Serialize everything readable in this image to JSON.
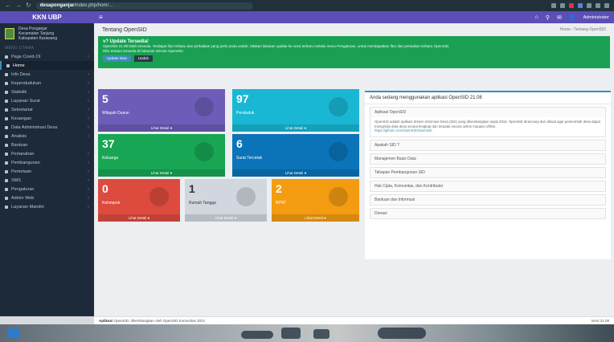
{
  "browser": {
    "url_host": "desaponganjar",
    "url_path": "/index.php/hom/...",
    "nav_back": "←",
    "nav_forward": "→",
    "nav_reload": "↻"
  },
  "sidebar": {
    "brand": "KKN UBP",
    "village_lines": [
      "Desa Ponganjar",
      "Kecamatan Tanjung",
      "Kabupaten Karawang"
    ],
    "menu_header": "MENU UTAMA",
    "items": [
      {
        "label": "Page Covid-19",
        "chevron": "‹"
      },
      {
        "label": "Home",
        "chevron": ""
      },
      {
        "label": "Info Desa",
        "chevron": "‹"
      },
      {
        "label": "Kependudukan",
        "chevron": "‹"
      },
      {
        "label": "Statistik",
        "chevron": "‹"
      },
      {
        "label": "Layanan Surat",
        "chevron": "‹"
      },
      {
        "label": "Sekretariat",
        "chevron": "‹"
      },
      {
        "label": "Keuangan",
        "chevron": "‹"
      },
      {
        "label": "Data Administrasi Desa",
        "chevron": "‹"
      },
      {
        "label": "Analisis",
        "chevron": "‹"
      },
      {
        "label": "Bantuan",
        "chevron": ""
      },
      {
        "label": "Pertanahan",
        "chevron": "‹"
      },
      {
        "label": "Pembangunan",
        "chevron": "‹"
      },
      {
        "label": "Pemetaan",
        "chevron": "‹"
      },
      {
        "label": "SMS",
        "chevron": "‹"
      },
      {
        "label": "Pengaturan",
        "chevron": "‹"
      },
      {
        "label": "Admin Web",
        "chevron": "‹"
      },
      {
        "label": "Layanan Mandiri",
        "chevron": "‹"
      }
    ]
  },
  "topbar": {
    "toggle": "≡",
    "admin_label": "Administrator"
  },
  "content": {
    "page_title": "Tentang OpenSID",
    "breadcrumb": "Home › Tentang OpenSID",
    "callout": {
      "title": "v? Update Tersedia!",
      "text": "OpenSID 21.08 telah tersedia. Terdapat fitur terbaru dan perbaikan yang perlu anda unduh. Silakan lakukan update ke versi terbaru melalui menu Pengaturan, untuk mendapatkan fitur dan perbaikan terbaru OpenSID.",
      "text2": "Rilis terbaru tersedia di halaman GitHub OpenSID.",
      "btn_primary": "Update Now",
      "btn_secondary": "Unduh"
    },
    "boxes": [
      {
        "num": "5",
        "label": "Wilayah Dusun",
        "footer": "Lihat Detail ●"
      },
      {
        "num": "97",
        "label": "Penduduk",
        "footer": "Lihat Detail ●"
      },
      {
        "num": "37",
        "label": "Keluarga",
        "footer": "Lihat Detail ●"
      },
      {
        "num": "6",
        "label": "Surat Tercetak",
        "footer": "Lihat Detail ●"
      },
      {
        "num": "0",
        "label": "Kelompok",
        "footer": "Lihat Detail ●"
      },
      {
        "num": "1",
        "label": "Rumah Tangga",
        "footer": "Lihat Detail ●"
      },
      {
        "num": "2",
        "label": "BPNT",
        "footer": "Lihat Detail ●"
      }
    ],
    "info": {
      "heading": "Anda sedang menggunakan aplikasi OpenSID 21.08",
      "sections": [
        {
          "title": "Aplikasi OpenSID",
          "body": "OpenSID adalah aplikasi Sistem Informasi Desa (SID) yang dikembangkan sejak 2016. OpenSID dirancang dan dibuat agar pemerintah desa dapat mengelola data desa secara lengkap dan terpadu secara online maupun offline.",
          "link": "https://github.com/OpenSID/OpenSID"
        },
        {
          "title": "Apakah SID ?",
          "body": "",
          "link": ""
        },
        {
          "title": "Manajemen Basis Data",
          "body": "",
          "link": ""
        },
        {
          "title": "Tahapan Pembangunan SID",
          "body": "",
          "link": ""
        },
        {
          "title": "Hak Cipta, Komunitas, dan Kontributor",
          "body": "",
          "link": ""
        },
        {
          "title": "Bantuan dan Informasi",
          "body": "",
          "link": ""
        },
        {
          "title": "Donasi",
          "body": "",
          "link": ""
        }
      ]
    }
  },
  "footer": {
    "left_bold": "Aplikasi",
    "left": "OpenSID, dikembangkan oleh OpenSID Komunitas 2021",
    "right": "Versi 21.08"
  }
}
